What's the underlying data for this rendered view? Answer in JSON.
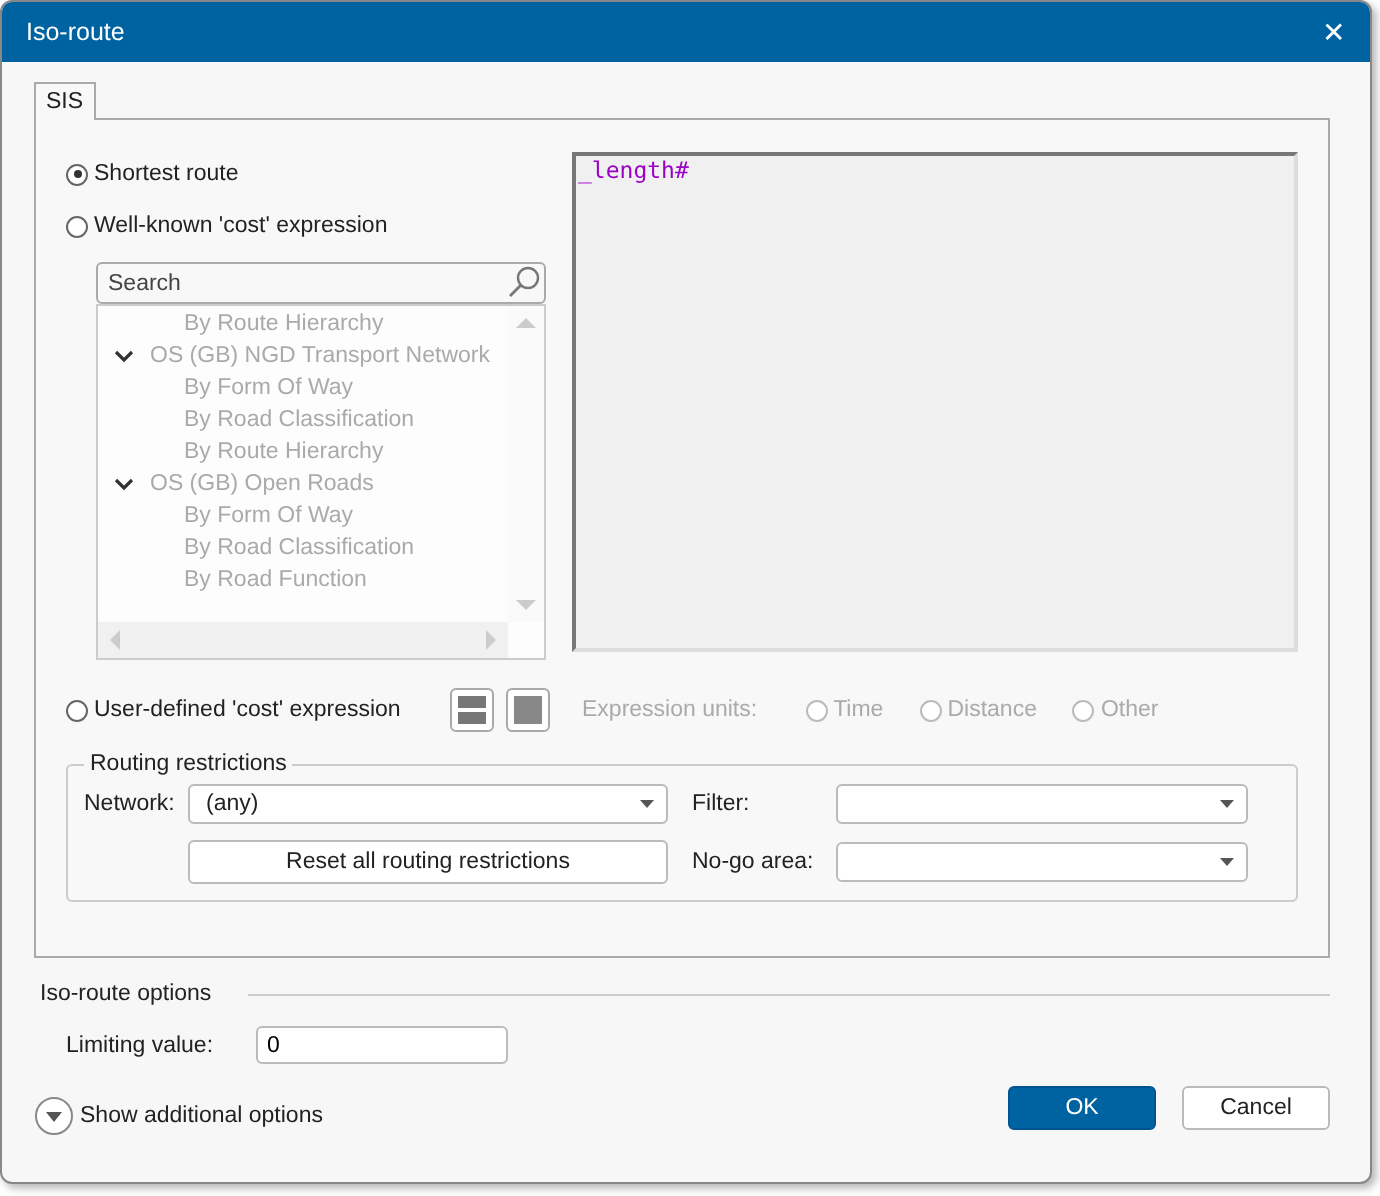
{
  "window": {
    "title": "Iso-route",
    "close": "✕"
  },
  "tabs": [
    {
      "label": "SIS",
      "selected": true
    }
  ],
  "cost_options": [
    {
      "label": "Shortest route",
      "selected": true
    },
    {
      "label": "Well-known 'cost' expression",
      "selected": false
    }
  ],
  "search": {
    "placeholder": "Search"
  },
  "tree": {
    "continued_children": [
      {
        "label": "By Route Hierarchy"
      }
    ],
    "items": [
      {
        "label": "OS (GB) NGD Transport Network",
        "expanded": true,
        "children": [
          {
            "label": "By Form Of Way"
          },
          {
            "label": "By Road Classification"
          },
          {
            "label": "By Route Hierarchy"
          }
        ]
      },
      {
        "label": "OS (GB) Open Roads",
        "expanded": true,
        "children": [
          {
            "label": "By Form Of Way"
          },
          {
            "label": "By Road Classification"
          },
          {
            "label": "By Road Function"
          }
        ]
      }
    ]
  },
  "expression": "_length#",
  "user_defined": {
    "label": "User-defined 'cost' expression",
    "selected": false
  },
  "expression_units": {
    "label": "Expression units:",
    "disabled": true,
    "options": [
      {
        "label": "Time",
        "selected": false
      },
      {
        "label": "Distance",
        "selected": false
      },
      {
        "label": "Other",
        "selected": false
      }
    ]
  },
  "routing_restrictions": {
    "title": "Routing restrictions",
    "network_label": "Network:",
    "network_value": "(any)",
    "reset_button": "Reset all routing restrictions",
    "filter_label": "Filter:",
    "no_go_label": "No-go area:"
  },
  "iso_route_options": {
    "title": "Iso-route options",
    "limiting_label": "Limiting value:",
    "limiting_value": "0",
    "show_more": "Show additional options"
  },
  "buttons": [
    {
      "label": "OK",
      "kind": "primary"
    },
    {
      "label": "Cancel",
      "kind": "normal"
    }
  ]
}
